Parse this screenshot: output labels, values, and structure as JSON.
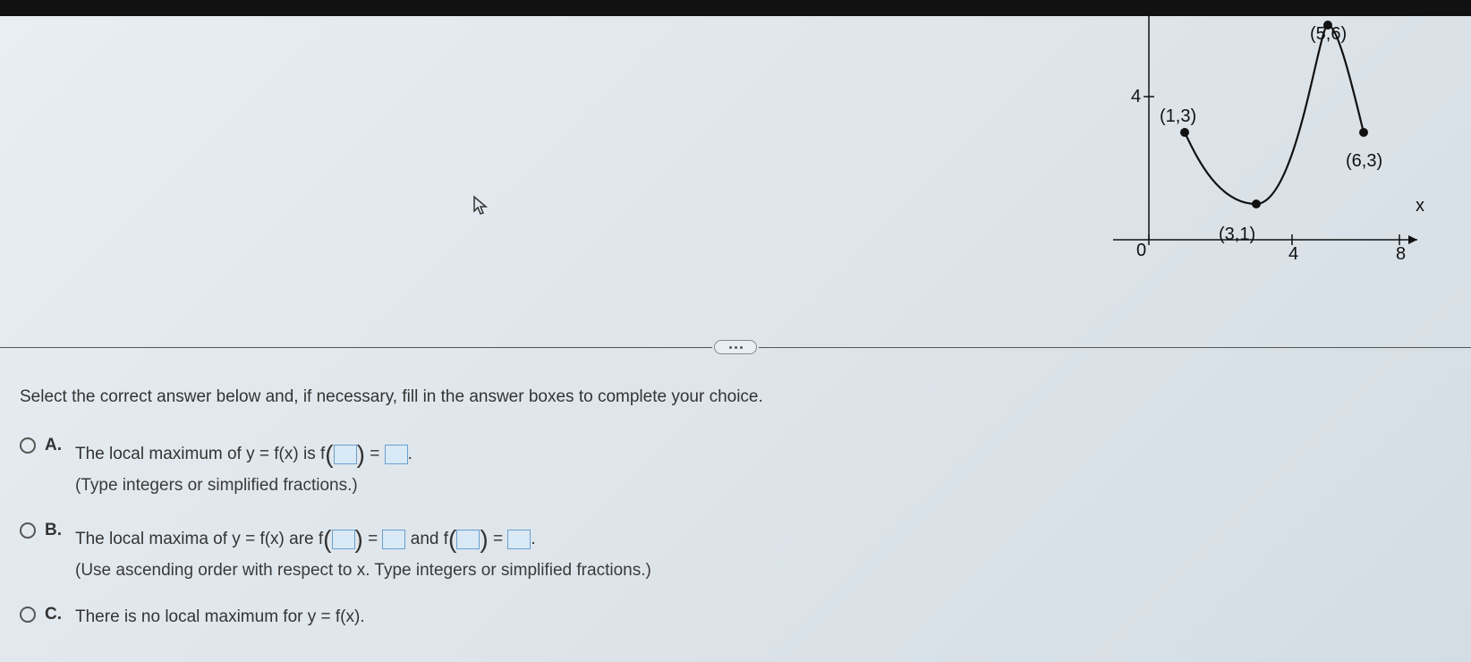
{
  "instruction": "Select the correct answer below and, if necessary, fill in the answer boxes to complete your choice.",
  "options": {
    "A": {
      "letter": "A.",
      "text_pre": "The local maximum of y = f(x) is f",
      "text_mid": " = ",
      "hint": "(Type integers or simplified fractions.)"
    },
    "B": {
      "letter": "B.",
      "text_pre": "The local maxima of y = f(x) are f",
      "text_mid1": " = ",
      "text_and": " and f",
      "text_mid2": " = ",
      "hint": "(Use ascending order with respect to x. Type integers or simplified fractions.)"
    },
    "C": {
      "letter": "C.",
      "text": "There is no local maximum for y = f(x)."
    }
  },
  "chart_data": {
    "type": "line",
    "title": "",
    "xlabel": "x",
    "ylabel": "",
    "xlim": [
      0,
      8
    ],
    "ylim": [
      0,
      6
    ],
    "x_ticks": [
      4,
      8
    ],
    "y_ticks_labeled": [
      4
    ],
    "origin_label": "0",
    "points_labeled": [
      {
        "x": 1,
        "y": 3,
        "label": "(1,3)"
      },
      {
        "x": 3,
        "y": 1,
        "label": "(3,1)"
      },
      {
        "x": 5,
        "y": 6,
        "label": "(5,6)"
      },
      {
        "x": 6,
        "y": 3,
        "label": "(6,3)"
      }
    ],
    "curve_note": "Curve starts at (1,3), dips to min (3,1), rises to max (5,6), falls to (6,3)."
  },
  "graph_labels": {
    "origin": "0",
    "y4": "4",
    "x4": "4",
    "x8": "8",
    "x_axis": "x",
    "p1": "(1,3)",
    "p2": "(3,1)",
    "p3": "(5,6)",
    "p4": "(6,3)"
  }
}
